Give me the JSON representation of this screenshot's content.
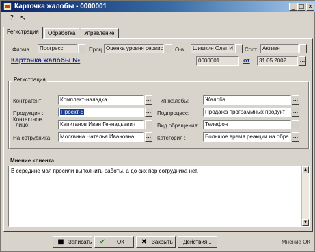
{
  "window": {
    "title": "Карточка жалобы - 0000001"
  },
  "title_buttons": {
    "minimize": "_",
    "maximize": "□",
    "close": "×"
  },
  "toolbar": {
    "help_glyph": "?",
    "pointer_glyph": "↖"
  },
  "tabs": [
    {
      "label": "Регистрация"
    },
    {
      "label": "Обработка"
    },
    {
      "label": "Управление"
    }
  ],
  "top_row": {
    "firm_label": "Фирма",
    "firm_value": "Прогресс",
    "proc_label": "Проц.",
    "proc_value": "Оценка уровня сервис",
    "resp_label": "О-в.",
    "resp_value": "Шишкин Олег И",
    "status_label": "Сост.",
    "status_value": "Активн"
  },
  "complaint": {
    "link_label": "Карточка жалобы  №",
    "number": "0000001",
    "from_label": "от",
    "date": "31.05.2002"
  },
  "registration": {
    "group_label": "Регистрация",
    "counterparty_label": "Контрагент:",
    "counterparty_value": "Комплект-наладка",
    "product_label": "Продукция :",
    "product_value": "Проект-5",
    "contact_label_1": "Контактное",
    "contact_label_2": "лицо:",
    "contact_value": "Капитанов Иван Геннадьевич",
    "employee_label": "На сотрудника:",
    "employee_value": "Москвина Наталья Ивановна",
    "type_label": "Тип жалобы:",
    "type_value": "Жалоба",
    "subprocess_label": "Подпроцесс:",
    "subprocess_value": "Продажа программных продукт",
    "channel_label": "Вид обращения:",
    "channel_value": "Телефон",
    "category_label": "Категория :",
    "category_value": "Большое время реакции на обра"
  },
  "client_opinion": {
    "label": "Мнение клиента",
    "text": "В середине мая просили выполнить работы, а до сих пор сотрудника нет."
  },
  "buttons": {
    "save": "Записать",
    "ok": "ОК",
    "close": "Закрыть",
    "actions": "Действия..."
  },
  "status_text": "Мнение ОК",
  "colors": {
    "title_start": "#0a246a",
    "title_end": "#a6caf0",
    "link": "#1a2c8c",
    "selection": "#1a3c8c"
  }
}
